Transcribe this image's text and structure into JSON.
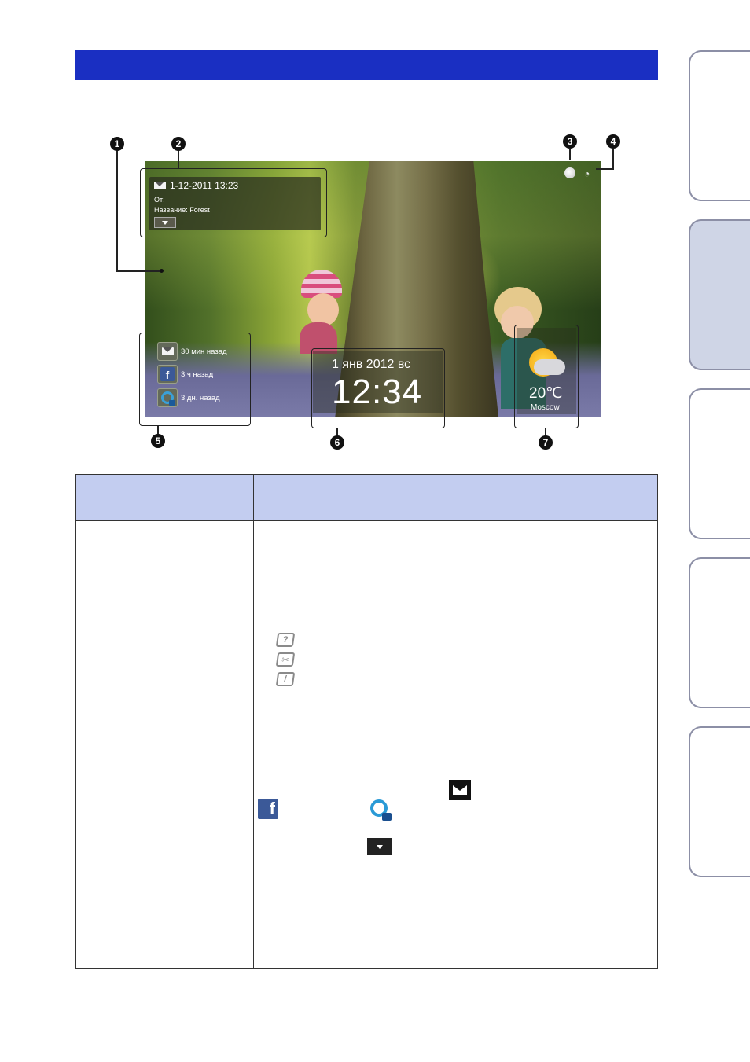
{
  "figure": {
    "message": {
      "datetime": "1-12-2011   13:23",
      "from_label": "От:",
      "subject": "Название: Forest"
    },
    "notifications": [
      {
        "icon": "envelope-icon",
        "text": "30 мин назад"
      },
      {
        "icon": "facebook-icon",
        "text": "3 ч назад"
      },
      {
        "icon": "photo-service-icon",
        "text": "3 дн. назад"
      }
    ],
    "clock": {
      "date": "1 янв 2012 вс",
      "time": "12:34"
    },
    "weather": {
      "temperature": "20℃",
      "city": "Moscow"
    },
    "callouts": [
      "1",
      "2",
      "3",
      "4",
      "5",
      "6",
      "7"
    ]
  },
  "indicator_icons": [
    "?",
    "✂",
    "/"
  ],
  "colors": {
    "title_bar": "#1a2fc2",
    "table_header": "#c3cdf0",
    "facebook": "#3b5998"
  }
}
